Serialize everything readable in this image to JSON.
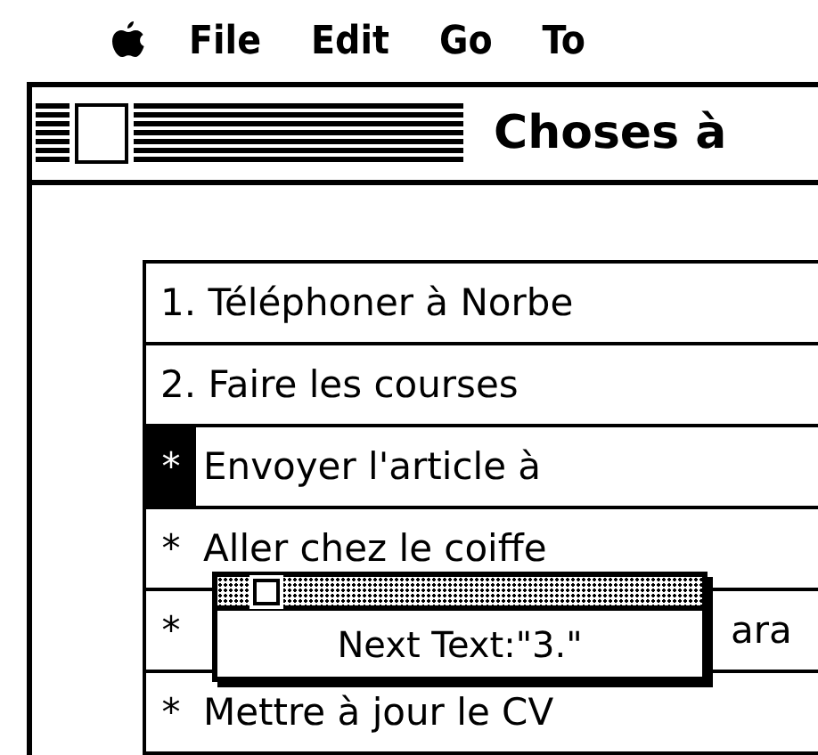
{
  "menu_bar": {
    "items": [
      {
        "label": "File"
      },
      {
        "label": "Edit"
      },
      {
        "label": "Go"
      },
      {
        "label": "To"
      }
    ]
  },
  "window": {
    "title": "Choses à"
  },
  "list": {
    "items": [
      {
        "kind": "plain",
        "marker": "",
        "text": "1. Téléphoner à Norbe",
        "selected": false
      },
      {
        "kind": "plain",
        "marker": "",
        "text": "2. Faire les courses",
        "selected": false
      },
      {
        "kind": "plain",
        "marker": "*",
        "text": "Envoyer l'article à",
        "selected": true
      },
      {
        "kind": "plain",
        "marker": "*",
        "text": "Aller chez le coiffe",
        "selected": false
      },
      {
        "kind": "covered",
        "marker": "*",
        "text": "ara",
        "selected": false
      },
      {
        "kind": "plain",
        "marker": "*",
        "text": "Mettre à jour le CV",
        "selected": false
      }
    ]
  },
  "popup": {
    "message": "Next Text:\"3.\""
  }
}
